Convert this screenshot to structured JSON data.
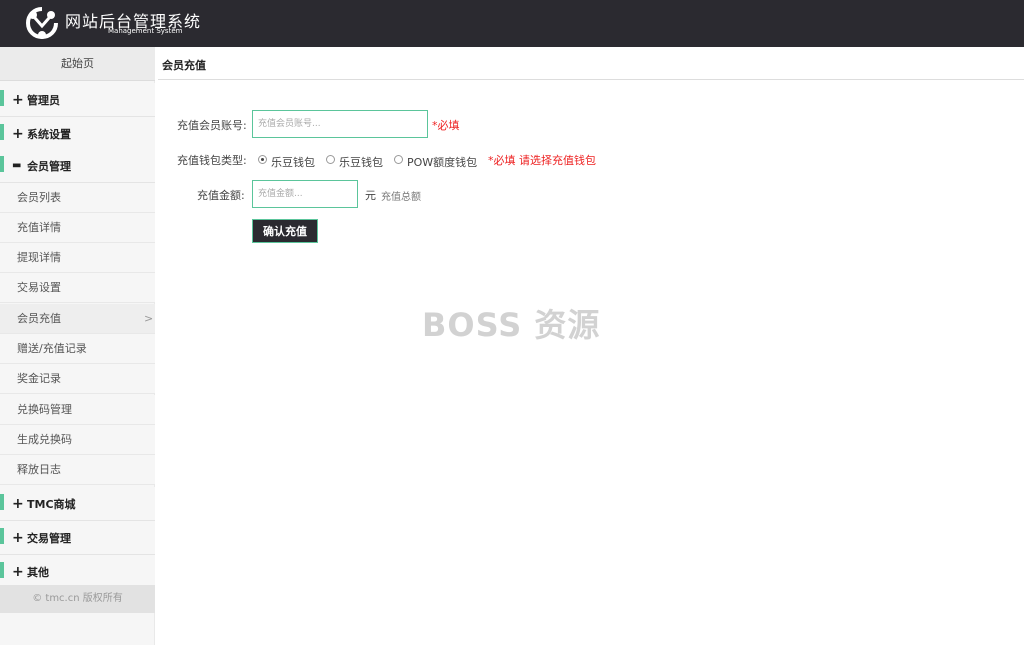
{
  "header": {
    "title": "网站后台管理系统",
    "subtitle": "Management System",
    "logo_icon": "logo-icon"
  },
  "sidebar": {
    "home": "起始页",
    "groups": [
      {
        "label": "管理员",
        "expanded": false,
        "icon": "plus-icon"
      },
      {
        "label": "系统设置",
        "expanded": false,
        "icon": "plus-icon"
      },
      {
        "label": "会员管理",
        "expanded": true,
        "icon": "minus-icon"
      },
      {
        "label": "TMC商城",
        "expanded": false,
        "icon": "plus-icon"
      },
      {
        "label": "交易管理",
        "expanded": false,
        "icon": "plus-icon"
      },
      {
        "label": "其他",
        "expanded": false,
        "icon": "plus-icon"
      }
    ],
    "member_items": [
      {
        "label": "会员列表"
      },
      {
        "label": "充值详情"
      },
      {
        "label": "提现详情"
      },
      {
        "label": "交易设置"
      },
      {
        "label": "会员充值",
        "active": true
      },
      {
        "label": "赠送/充值记录"
      },
      {
        "label": "奖金记录"
      },
      {
        "label": "兑换码管理"
      },
      {
        "label": "生成兑换码"
      },
      {
        "label": "释放日志"
      }
    ],
    "footer": "© tmc.cn 版权所有"
  },
  "main": {
    "title": "会员充值",
    "form": {
      "account_label": "充值会员账号:",
      "account_placeholder": "充值会员账号...",
      "account_required": "*必填",
      "wallet_label": "充值钱包类型:",
      "wallet_options": [
        {
          "label": "乐豆钱包",
          "checked": true
        },
        {
          "label": "乐豆钱包",
          "checked": false
        },
        {
          "label": "POW额度钱包",
          "checked": false
        }
      ],
      "wallet_required": "*必填 请选择充值钱包",
      "amount_label": "充值金额:",
      "amount_placeholder": "充值金额...",
      "amount_unit": "元",
      "amount_hint": "充值总额",
      "submit": "确认充值"
    }
  },
  "watermark": "BOSS 资源",
  "colors": {
    "header_bg": "#2b2a30",
    "accent": "#5bc59b",
    "required": "#e22222",
    "sidebar_bg": "#f6f6f6"
  }
}
